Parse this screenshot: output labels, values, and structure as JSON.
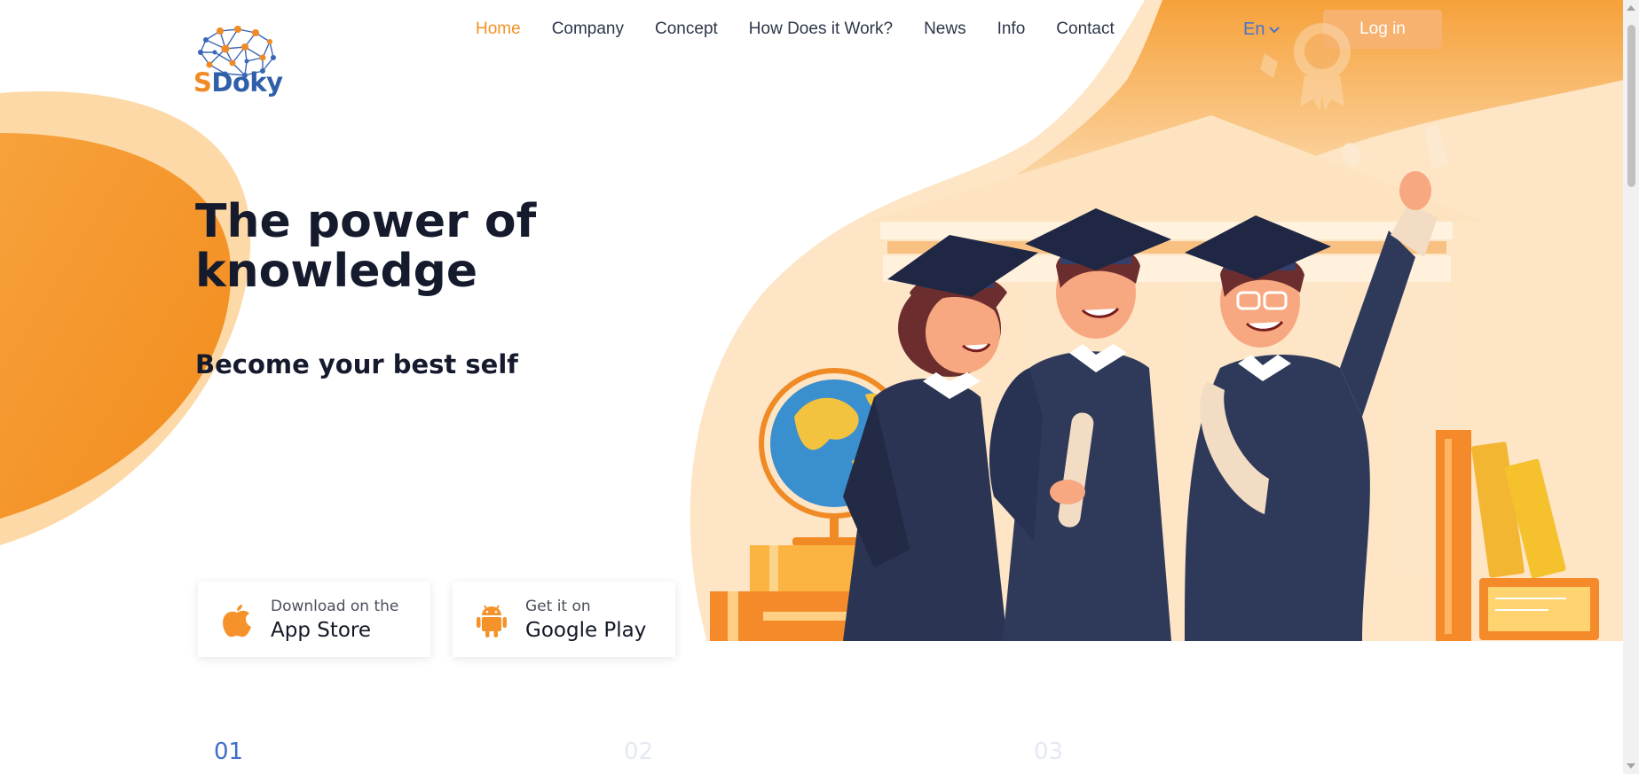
{
  "brand": {
    "name_s": "S",
    "name_rest": "Doky"
  },
  "nav": {
    "items": [
      {
        "label": "Home",
        "active": true
      },
      {
        "label": "Company",
        "active": false
      },
      {
        "label": "Concept",
        "active": false
      },
      {
        "label": "How Does it Work?",
        "active": false
      },
      {
        "label": "News",
        "active": false
      },
      {
        "label": "Info",
        "active": false
      },
      {
        "label": "Contact",
        "active": false
      }
    ]
  },
  "header": {
    "language": "En",
    "login_label": "Log in"
  },
  "hero": {
    "title": "The power of knowledge",
    "subtitle": "Become your best self"
  },
  "stores": {
    "app": {
      "small": "Download on the",
      "big": "App Store",
      "icon": "apple-icon"
    },
    "play": {
      "small": "Get it on",
      "big": "Google Play",
      "icon": "android-icon"
    }
  },
  "steps": [
    "01",
    "02",
    "03"
  ],
  "colors": {
    "accent": "#f5922a",
    "brand_blue": "#2f5fa8",
    "login_bg": "#f7b270",
    "dark_text": "#151a2d"
  }
}
